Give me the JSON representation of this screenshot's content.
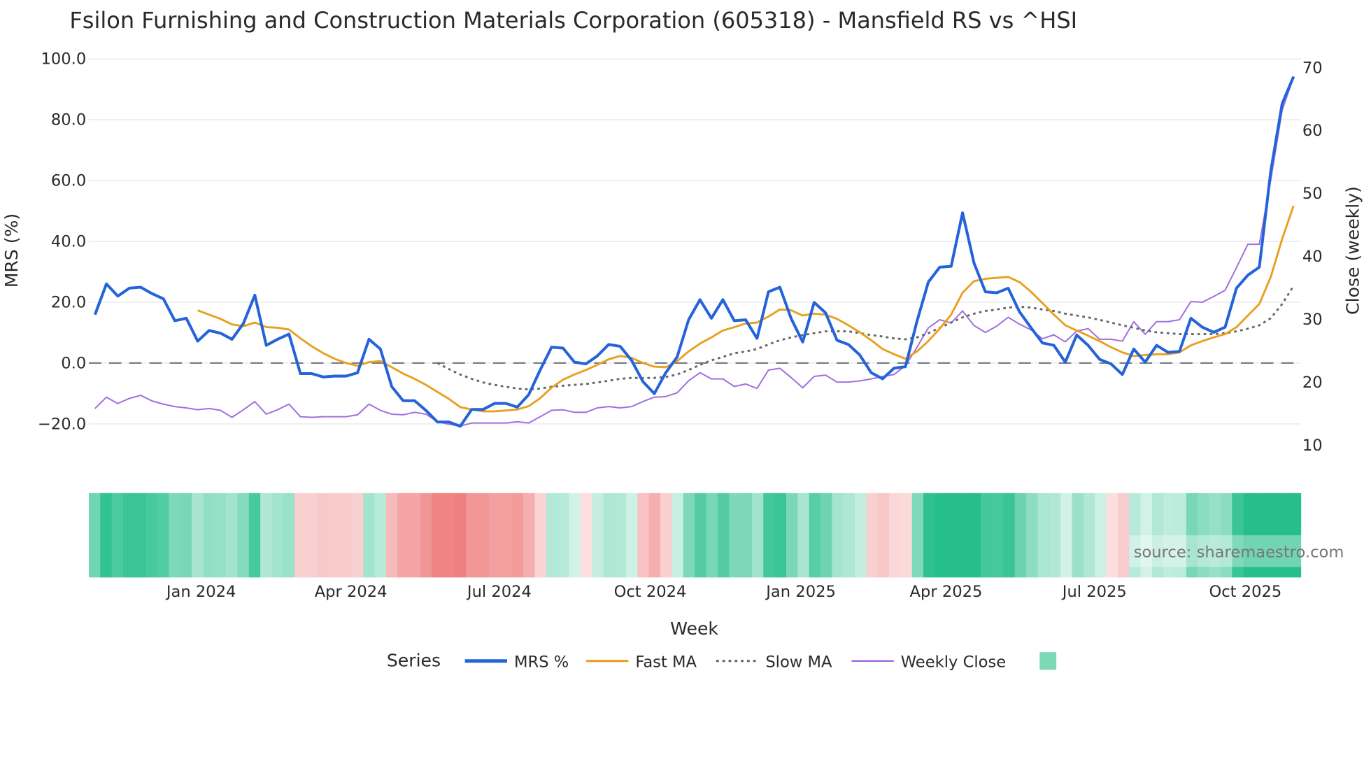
{
  "chart_data": {
    "type": "line",
    "title": "Fsilon Furnishing and Construction Materials Corporation (605318) - Mansfield RS vs ^HSI",
    "xlabel": "Week",
    "ylabel": "MRS (%)",
    "y2label": "Close (weekly)",
    "ylim": [
      -20,
      100
    ],
    "y2lim": [
      10,
      70
    ],
    "yticks": [
      "100.0",
      "80.0",
      "60.0",
      "40.0",
      "20.0",
      "0.0",
      "−20.0"
    ],
    "ytick_values": [
      100,
      80,
      60,
      40,
      20,
      0,
      -20
    ],
    "y2ticks": [
      "70",
      "60",
      "50",
      "40",
      "30",
      "20",
      "10"
    ],
    "y2tick_values": [
      70,
      60,
      50,
      40,
      30,
      20,
      10
    ],
    "xticks": [
      {
        "label": "Jan 2024",
        "week_index": 9.3
      },
      {
        "label": "Apr 2024",
        "week_index": 22.4
      },
      {
        "label": "Jul 2024",
        "week_index": 35.4
      },
      {
        "label": "Oct 2024",
        "week_index": 48.6
      },
      {
        "label": "Jan 2025",
        "week_index": 61.8
      },
      {
        "label": "Apr 2025",
        "week_index": 74.5
      },
      {
        "label": "Jul 2025",
        "week_index": 87.5
      },
      {
        "label": "Oct 2025",
        "week_index": 100.7
      }
    ],
    "zero_line": 0,
    "grid": true,
    "legend_title": "Series",
    "legend_placement": "bottom-center",
    "series": [
      {
        "name": "MRS %",
        "axis": "left",
        "color": "#2563d9",
        "style": "solid",
        "values": [
          15.9,
          26.0,
          22.0,
          24.6,
          24.9,
          22.8,
          21.1,
          13.9,
          14.7,
          7.2,
          10.7,
          9.8,
          7.8,
          13.0,
          22.3,
          5.8,
          7.8,
          9.5,
          -3.5,
          -3.5,
          -4.6,
          -4.3,
          -4.3,
          -3.2,
          7.8,
          4.6,
          -7.8,
          -12.4,
          -12.4,
          -15.6,
          -19.4,
          -19.4,
          -20.8,
          -15.3,
          -15.3,
          -13.3,
          -13.3,
          -14.5,
          -10.4,
          -2.3,
          5.2,
          4.9,
          0.3,
          -0.3,
          2.3,
          6.1,
          5.5,
          0.9,
          -6.1,
          -10.1,
          -3.2,
          2.0,
          14.2,
          20.8,
          14.7,
          20.8,
          13.9,
          14.2,
          8.1,
          23.4,
          24.9,
          14.5,
          6.9,
          19.9,
          16.5,
          7.5,
          6.1,
          2.6,
          -3.2,
          -5.2,
          -1.7,
          -1.2,
          13.6,
          26.6,
          31.5,
          31.8,
          49.4,
          32.9,
          23.4,
          23.1,
          24.6,
          16.8,
          11.6,
          6.6,
          5.8,
          0.3,
          9.2,
          5.8,
          1.2,
          -0.3,
          -3.8,
          4.6,
          0.3,
          5.8,
          3.5,
          3.8,
          14.7,
          11.8,
          10.1,
          11.8,
          24.6,
          28.9,
          31.5,
          63.0,
          85.3,
          94.2
        ]
      },
      {
        "name": "Fast MA",
        "axis": "left",
        "color": "#e8a020",
        "style": "solid",
        "values": [
          17.3,
          15.9,
          14.5,
          12.7,
          12.1,
          13.3,
          11.8,
          11.6,
          11.0,
          8.1,
          5.5,
          3.2,
          1.4,
          0,
          -0.9,
          0.3,
          0.6,
          -1.4,
          -3.5,
          -5.2,
          -7.2,
          -9.5,
          -11.8,
          -14.5,
          -15.3,
          -15.9,
          -15.9,
          -15.6,
          -15.3,
          -14.2,
          -11.6,
          -8.1,
          -5.5,
          -3.8,
          -2.3,
          -0.6,
          1.2,
          2.3,
          1.7,
          0,
          -1.2,
          -1.4,
          0.6,
          3.8,
          6.4,
          8.4,
          10.7,
          11.8,
          13.0,
          13.3,
          15.3,
          17.6,
          17.3,
          15.6,
          16.2,
          15.9,
          14.5,
          12.4,
          10.1,
          7.5,
          4.6,
          2.9,
          1.4,
          3.8,
          7.2,
          11.3,
          15.9,
          23.1,
          26.9,
          27.7,
          28.0,
          28.3,
          26.6,
          23.4,
          19.7,
          15.9,
          12.4,
          10.7,
          9.0,
          7.2,
          5.2,
          3.5,
          2.3,
          2.6,
          2.9,
          2.9,
          3.5,
          5.8,
          7.2,
          8.4,
          9.5,
          11.8,
          15.6,
          19.4,
          28.3,
          40.8,
          51.7
        ]
      },
      {
        "name": "Slow MA",
        "axis": "left",
        "color": "#666666",
        "style": "dotted",
        "values": [
          0,
          -2.0,
          -3.8,
          -5.2,
          -6.4,
          -7.2,
          -7.8,
          -8.4,
          -8.7,
          -8.4,
          -7.8,
          -7.5,
          -7.2,
          -6.9,
          -6.4,
          -5.8,
          -5.2,
          -4.9,
          -4.9,
          -4.9,
          -4.6,
          -3.8,
          -2.3,
          -0.6,
          0.9,
          2.0,
          3.2,
          3.8,
          4.6,
          6.1,
          7.5,
          8.4,
          9.2,
          9.8,
          10.4,
          10.4,
          10.4,
          9.8,
          9.2,
          8.7,
          8.1,
          7.8,
          8.4,
          9.8,
          11.6,
          13.3,
          15.0,
          16.2,
          17.1,
          17.6,
          18.2,
          18.5,
          18.2,
          17.6,
          17.1,
          16.2,
          15.6,
          15.0,
          14.2,
          13.3,
          12.4,
          11.6,
          10.7,
          10.1,
          9.8,
          9.5,
          9.5,
          9.5,
          9.5,
          9.8,
          10.4,
          11.3,
          12.4,
          14.7,
          19.4,
          25.4
        ]
      },
      {
        "name": "Weekly Close",
        "axis": "right",
        "color": "#a070e0",
        "style": "solid",
        "values": [
          15.7,
          17.5,
          16.5,
          17.3,
          17.8,
          16.9,
          16.4,
          16.0,
          15.8,
          15.5,
          15.7,
          15.4,
          14.3,
          15.5,
          16.8,
          14.8,
          15.5,
          16.4,
          14.4,
          14.3,
          14.4,
          14.4,
          14.4,
          14.7,
          16.4,
          15.4,
          14.8,
          14.7,
          15.1,
          14.8,
          13.6,
          13.2,
          12.9,
          13.4,
          13.4,
          13.4,
          13.4,
          13.6,
          13.4,
          14.4,
          15.4,
          15.5,
          15.1,
          15.1,
          15.8,
          16.0,
          15.8,
          16.0,
          16.8,
          17.5,
          17.6,
          18.2,
          20.1,
          21.4,
          20.4,
          20.4,
          19.2,
          19.6,
          18.9,
          21.8,
          22.1,
          20.6,
          19.0,
          20.8,
          21.0,
          19.9,
          19.9,
          20.1,
          20.4,
          20.8,
          21.1,
          22.5,
          25.4,
          28.5,
          29.8,
          29.3,
          31.2,
          28.9,
          27.8,
          28.8,
          30.2,
          29.1,
          28.2,
          26.8,
          27.4,
          26.3,
          28.0,
          28.4,
          26.7,
          26.7,
          26.4,
          29.5,
          27.5,
          29.5,
          29.5,
          29.8,
          32.7,
          32.6,
          33.5,
          34.5,
          38.1,
          41.8,
          41.8,
          52.0,
          63.1,
          68.4
        ]
      }
    ],
    "heatmap": {
      "based_on": "MRS %",
      "positive_color": "#26bf8c",
      "negative_color": "#f08080"
    },
    "legend_swatch_color": "#7dd9b5"
  },
  "watermark": "source: sharemaestro.com"
}
